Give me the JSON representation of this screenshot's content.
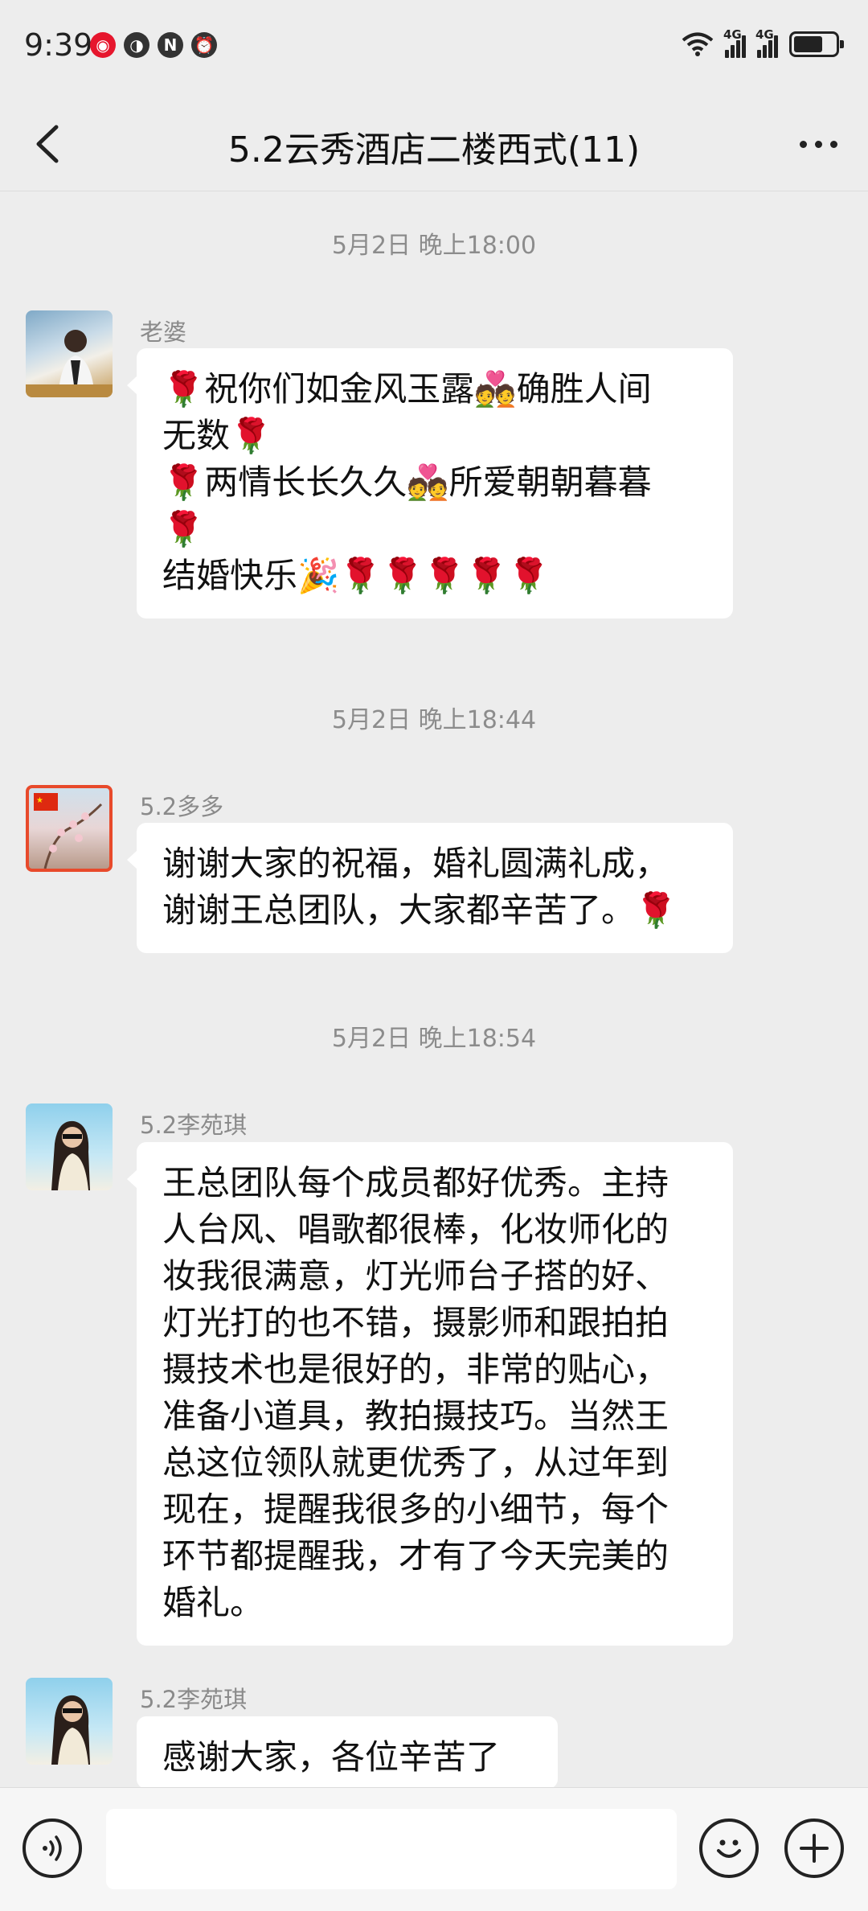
{
  "status_bar": {
    "time": "9:39",
    "network_label_1": "4G",
    "network_label_2": "4G",
    "left_icons": [
      "weibo-icon",
      "hd-icon",
      "nfc-icon",
      "alarm-icon"
    ],
    "right_icons": [
      "wifi-icon",
      "signal-icon",
      "signal-icon",
      "battery-icon"
    ]
  },
  "header": {
    "title": "5.2云秀酒店二楼西式(11)"
  },
  "messages": [
    {
      "timestamp": "5月2日 晚上18:00",
      "sender": "老婆",
      "text": "🌹祝你们如金风玉露💑确胜人间\n无数🌹\n🌹两情长长久久💑所爱朝朝暮暮\n🌹\n结婚快乐🎉🌹🌹🌹🌹🌹"
    },
    {
      "timestamp": "5月2日 晚上18:44",
      "sender": "5.2多多",
      "text": "谢谢大家的祝福，婚礼圆满礼成，\n谢谢王总团队，大家都辛苦了。🌹"
    },
    {
      "timestamp": "5月2日 晚上18:54",
      "sender": "5.2李苑琪",
      "text": "王总团队每个成员都好优秀。主持\n人台风、唱歌都很棒，化妆师化的\n妆我很满意，灯光师台子搭的好、\n灯光打的也不错，摄影师和跟拍拍\n摄技术也是很好的，非常的贴心，\n准备小道具，教拍摄技巧。当然王\n总这位领队就更优秀了，从过年到\n现在，提醒我很多的小细节，每个\n环节都提醒我，才有了今天完美的\n婚礼。"
    },
    {
      "sender": "5.2李苑琪",
      "text": "感谢大家，各位辛苦了"
    }
  ],
  "input_bar": {
    "value": "",
    "placeholder": ""
  }
}
